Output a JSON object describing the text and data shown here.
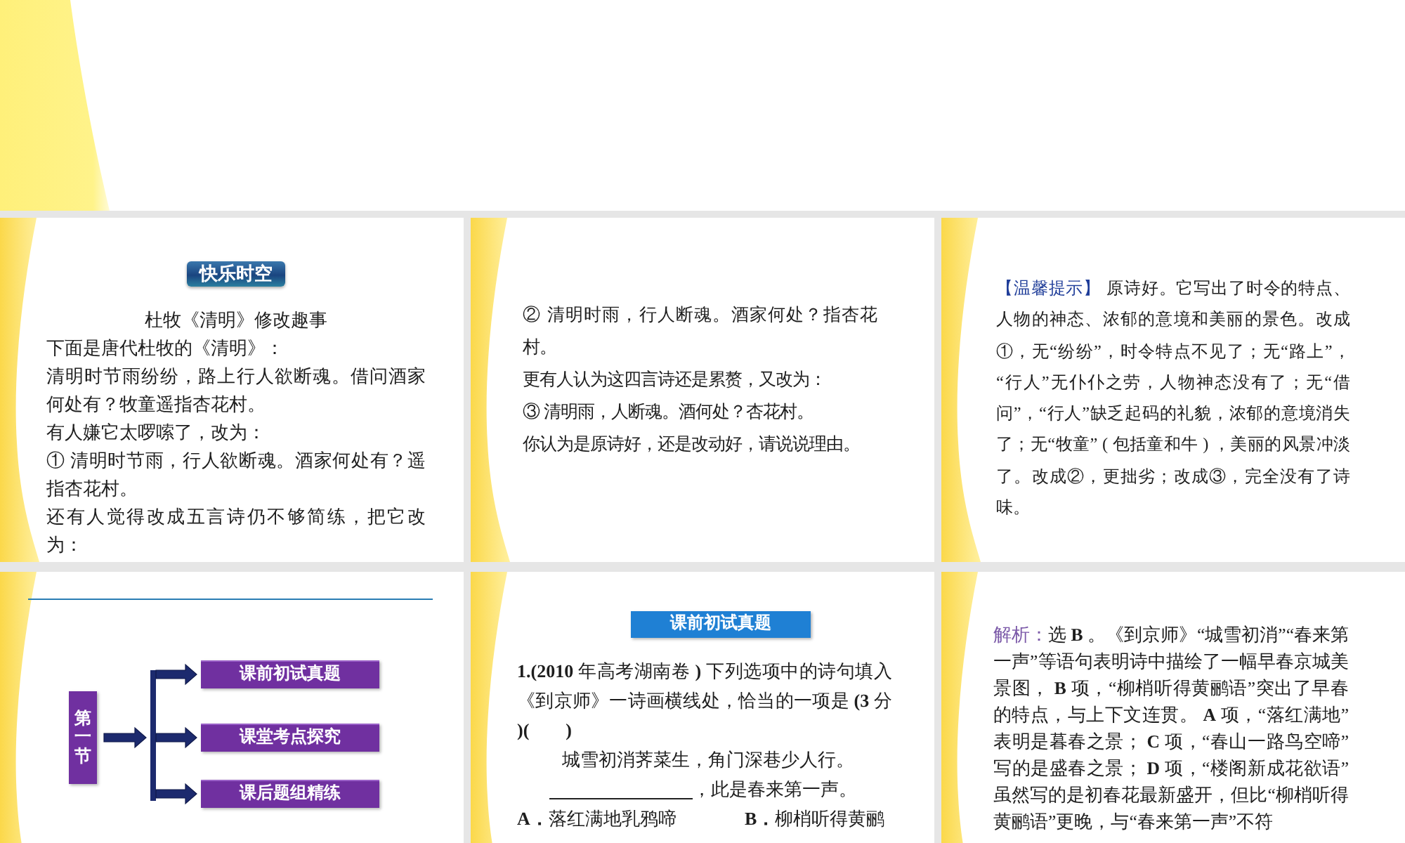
{
  "slides": [
    {
      "kind": "reading",
      "badge": "快乐时空",
      "title": "杜牧《清明》修改趣事",
      "paragraphs": [
        "下面是唐代杜牧的《清明》：",
        "清明时节雨纷纷，路上行人欲断魂。借问酒家何处有？牧童遥指杏花村。",
        "有人嫌它太啰嗦了，改为：",
        "① 清明时节雨，行人欲断魂。酒家何处有？遥指杏花村。",
        "还有人觉得改成五言诗仍不够简练，把它改为："
      ]
    },
    {
      "kind": "reading",
      "paragraphs": [
        "② 清明时雨，行人断魂。酒家何处？指杏花村。",
        "更有人认为这四言诗还是累赘，又改为：",
        "③ 清明雨，人断魂。酒何处？杏花村。",
        "你认为是原诗好，还是改动好，请说说理由。"
      ]
    },
    {
      "kind": "tip",
      "label": "【温馨提示】",
      "text": "原诗好。它写出了时令的特点、人物的神态、浓郁的意境和美丽的景色。改成①，无“纷纷”，时令特点不见了；无“路上”，“行人”无仆仆之劳，人物神态没有了；无“借问”，“行人”缺乏起码的礼貌，浓郁的意境消失了；无“牧童” ( 包括童和牛 ) ，美丽的风景冲淡了。改成②，更拙劣；改成③，完全没有了诗味。"
    },
    {
      "kind": "diagram",
      "root": "第一节",
      "branches": [
        "课前初试真题",
        "课堂考点探究",
        "课后题组精练"
      ]
    },
    {
      "kind": "question",
      "banner": "课前初试真题",
      "question": "**1.(2010** 年高考湖南卷 **)** 下列选项中的诗句填入《到京师》一诗画横线处，恰当的一项是 **(3** 分 **)(　　)**",
      "poem_line": "城雪初消荠菜生，角门深巷少人行。",
      "blank_line_suffix": "，此是春来第一声。",
      "options": [
        "**A．**落红满地乳鸦啼",
        "**B．**柳梢听得黄鹂"
      ]
    },
    {
      "kind": "analysis",
      "label": "解析：",
      "text": "选 **B** 。《到京师》“城雪初消”“春来第一声”等语句表明诗中描绘了一幅早春京城美景图， **B** 项，“柳梢听得黄鹂语”突出了早春的特点，与上下文连贯。 **A** 项，“落红满地”表明是暮春之景； **C** 项，“春山一路鸟空啼”写的是盛春之景； **D** 项，“楼阁新成花欲语”虽然写的是初春花最新盛开，但比“柳梢听得黄鹂语”更晚，与“春来第一声”不符"
    }
  ]
}
